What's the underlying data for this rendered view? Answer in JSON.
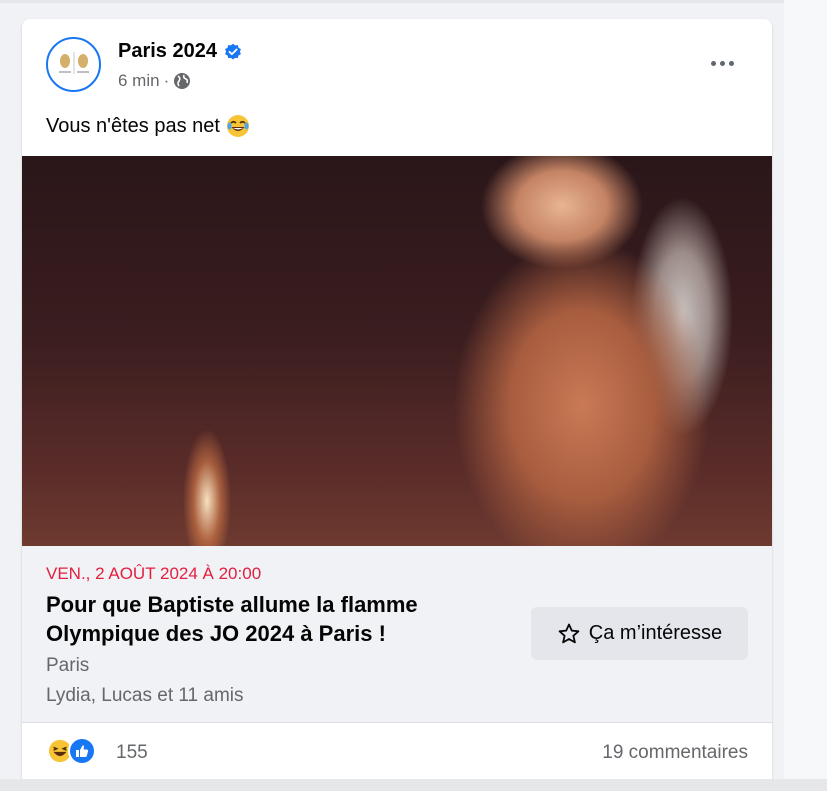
{
  "post": {
    "page_name": "Paris 2024",
    "time": "6 min",
    "separator": "·",
    "caption": "Vous n'êtes pas net",
    "caption_emoji": "😂"
  },
  "event": {
    "date": "VEN., 2 AOÛT 2024 À 20:00",
    "title": "Pour que Baptiste allume la flamme Olympique des JO 2024 à Paris !",
    "location": "Paris",
    "friends": "Lydia, Lucas et 11 amis",
    "interest_label": "Ça m’intéresse"
  },
  "footer": {
    "reaction_count": "155",
    "comments": "19 commentaires"
  },
  "colors": {
    "accent": "#1877f2",
    "date": "#e41e3f",
    "secondary_text": "#65676b"
  },
  "icons": [
    "verified-badge-icon",
    "globe-icon",
    "more-options-icon",
    "star-icon",
    "haha-reaction-icon",
    "like-reaction-icon"
  ]
}
